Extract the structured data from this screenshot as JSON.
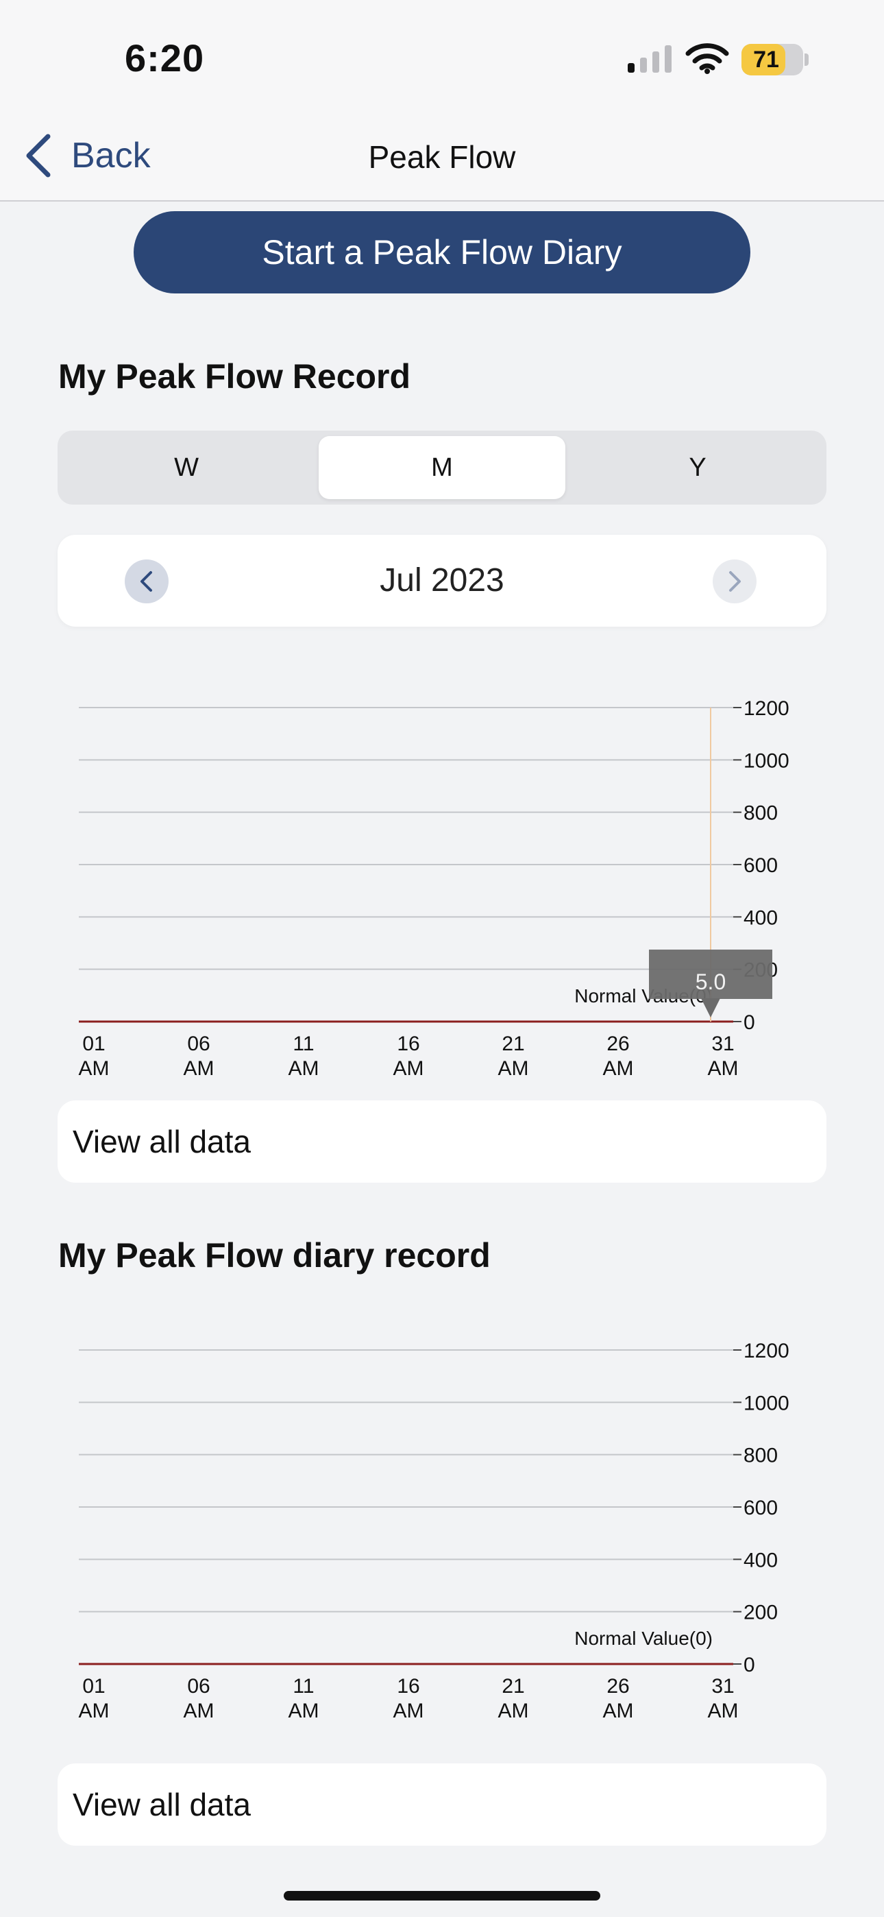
{
  "status_bar": {
    "time": "6:20",
    "battery": "71",
    "battery_level": 0.71
  },
  "navbar": {
    "back_label": "Back",
    "title": "Peak Flow"
  },
  "cta": {
    "label": "Start a Peak Flow Diary"
  },
  "record_section": {
    "title": "My Peak Flow Record"
  },
  "segments": [
    {
      "label": "W",
      "selected": false
    },
    {
      "label": "M",
      "selected": true
    },
    {
      "label": "Y",
      "selected": false
    }
  ],
  "month_nav": {
    "label": "Jul 2023"
  },
  "chart_data": [
    {
      "type": "line",
      "title": "",
      "x": [
        "01\nAM",
        "06\nAM",
        "11\nAM",
        "16\nAM",
        "21\nAM",
        "26\nAM",
        "31\nAM"
      ],
      "y_ticks": [
        "1200",
        "1000",
        "800",
        "600",
        "400",
        "200",
        "0"
      ],
      "ylim": [
        0,
        1200
      ],
      "grid": true,
      "annotations": [
        "Normal Value(0)"
      ],
      "tooltip": {
        "x": "31\nAM",
        "value": "5.0"
      },
      "normal_value": 0,
      "colors": {
        "normal_line": "#8b1f1f",
        "cursor_line": "#f0c9a0",
        "tooltip_bg": "#6b6b6b"
      }
    },
    {
      "type": "line",
      "title": "",
      "x": [
        "01\nAM",
        "06\nAM",
        "11\nAM",
        "16\nAM",
        "21\nAM",
        "26\nAM",
        "31\nAM"
      ],
      "y_ticks": [
        "1200",
        "1000",
        "800",
        "600",
        "400",
        "200",
        "0"
      ],
      "ylim": [
        0,
        1200
      ],
      "grid": true,
      "annotations": [
        "Normal Value(0)"
      ],
      "normal_value": 0,
      "colors": {
        "normal_line": "#8b1f1f"
      }
    }
  ],
  "view_all_1": {
    "label": "View all data"
  },
  "diary_section": {
    "title": "My Peak Flow diary record"
  },
  "view_all_2": {
    "label": "View all data"
  },
  "colors": {
    "accent": "#2b4676",
    "background": "#f2f3f5"
  }
}
